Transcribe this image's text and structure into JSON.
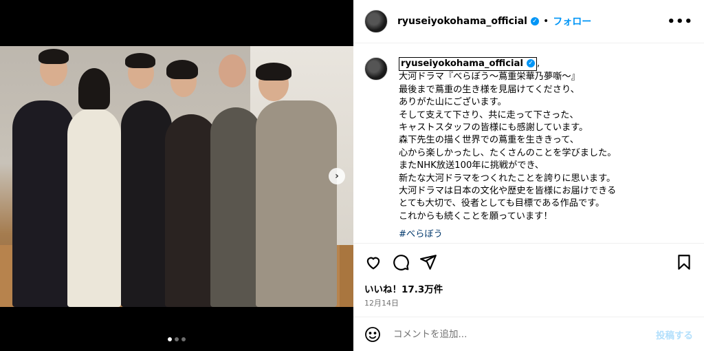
{
  "post": {
    "username": "ryuseiyokohama_official",
    "verified_icon": "verified-badge-icon",
    "separator": "•",
    "follow_label": "フォロー",
    "more_icon": "more-options-icon",
    "more_label": "•••"
  },
  "media": {
    "next_icon": "chevron-right-icon",
    "next_label": "›",
    "carousel_total": 3,
    "carousel_active": 1
  },
  "caption": {
    "username": "ryuseiyokohama_official",
    "suffix": ",",
    "lines": [
      "大河ドラマ『べらぼう〜蔦重栄華乃夢噺〜』",
      "最後まで蔦重の生き様を見届けてくださり、",
      "ありがた山にございます。",
      "そして支えて下さり、共に走って下さった、",
      "キャストスタッフの皆様にも感謝しています。",
      "森下先生の描く世界での蔦重を生ききって、",
      "心から楽しかったし、たくさんのことを学びました。",
      "またNHK放送100年に挑戦ができ、",
      "新たな大河ドラマをつくれたことを誇りに思います。",
      "大河ドラマは日本の文化や歴史を皆様にお届けできる",
      "とても大切で、役者としても目標である作品です。",
      "これからも続くことを願っています！"
    ],
    "hashtag": "#べらぼう"
  },
  "actions": {
    "like_icon": "heart-icon",
    "comment_icon": "comment-icon",
    "share_icon": "share-icon",
    "save_icon": "bookmark-icon"
  },
  "likes_text": "いいね！17.3万件",
  "date_text": "12月14日",
  "comment": {
    "emoji_icon": "emoji-icon",
    "placeholder": "コメントを追加...",
    "post_label": "投稿する"
  },
  "colors": {
    "accent": "#0095f6",
    "post_disabled": "#b2dffc",
    "hashtag": "#00376b"
  }
}
